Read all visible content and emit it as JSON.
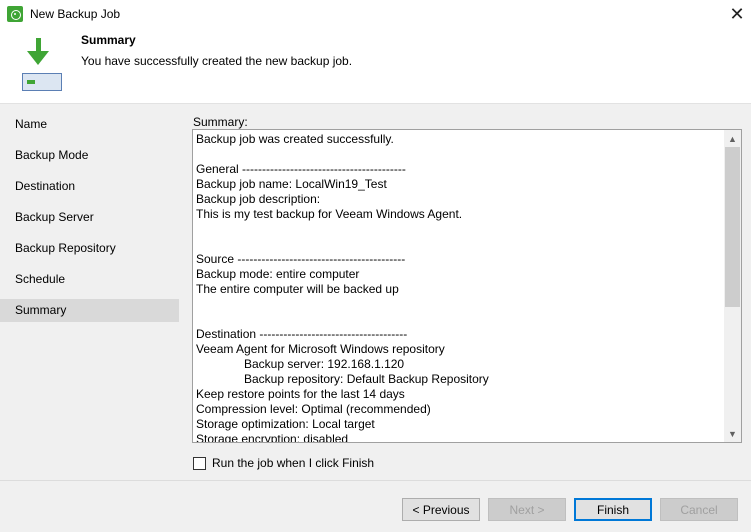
{
  "window": {
    "title": "New Backup Job",
    "close_label": "✕"
  },
  "header": {
    "title": "Summary",
    "subtitle": "You have successfully created the new backup job."
  },
  "sidebar": {
    "items": [
      {
        "label": "Name",
        "active": false
      },
      {
        "label": "Backup Mode",
        "active": false
      },
      {
        "label": "Destination",
        "active": false
      },
      {
        "label": "Backup Server",
        "active": false
      },
      {
        "label": "Backup Repository",
        "active": false
      },
      {
        "label": "Schedule",
        "active": false
      },
      {
        "label": "Summary",
        "active": true
      }
    ]
  },
  "summary": {
    "label": "Summary:",
    "lines": [
      {
        "text": "Backup job was created successfully.",
        "indent": false
      },
      {
        "text": "",
        "indent": false
      },
      {
        "text": "General -----------------------------------------",
        "indent": false
      },
      {
        "text": "Backup job name: LocalWin19_Test",
        "indent": false
      },
      {
        "text": "Backup job description:",
        "indent": false
      },
      {
        "text": "This is my test backup for Veeam Windows Agent.",
        "indent": false
      },
      {
        "text": "",
        "indent": false
      },
      {
        "text": "",
        "indent": false
      },
      {
        "text": "Source ------------------------------------------",
        "indent": false
      },
      {
        "text": "Backup mode: entire computer",
        "indent": false
      },
      {
        "text": "The entire computer will be backed up",
        "indent": false
      },
      {
        "text": "",
        "indent": false
      },
      {
        "text": "",
        "indent": false
      },
      {
        "text": "Destination -------------------------------------",
        "indent": false
      },
      {
        "text": "Veeam Agent for Microsoft Windows repository",
        "indent": false
      },
      {
        "text": "Backup server: 192.168.1.120",
        "indent": true
      },
      {
        "text": "Backup repository: Default Backup Repository",
        "indent": true
      },
      {
        "text": "Keep restore points for the last 14 days",
        "indent": false
      },
      {
        "text": "Compression level: Optimal (recommended)",
        "indent": false
      },
      {
        "text": "Storage optimization: Local target",
        "indent": false
      },
      {
        "text": "Storage encryption: disabled",
        "indent": false
      }
    ]
  },
  "run_checkbox": {
    "label": "Run the job when I click Finish",
    "checked": false
  },
  "buttons": {
    "previous": "< Previous",
    "next": "Next >",
    "finish": "Finish",
    "cancel": "Cancel"
  },
  "colors": {
    "accent_green": "#3fa535",
    "default_button_border": "#0078d7",
    "selected_nav": "#d9d9d9"
  }
}
